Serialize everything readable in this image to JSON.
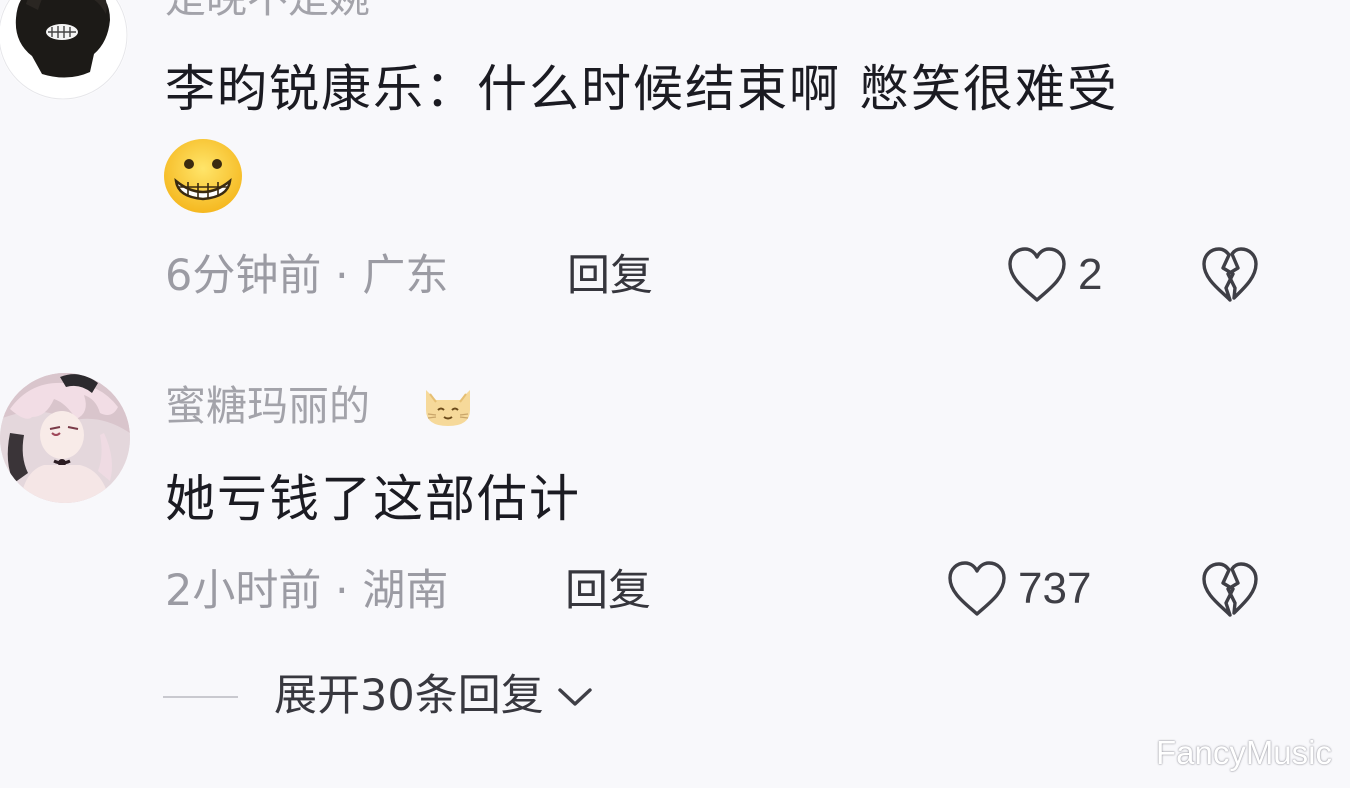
{
  "comments": [
    {
      "username": "是晚不是婉",
      "text": "李昀锐康乐：什么时候结束啊 憋笑很难受",
      "time_location": "6分钟前 · 广东",
      "reply_label": "回复",
      "like_count": "2",
      "emoji": "grinning-face"
    },
    {
      "username": "蜜糖玛丽的",
      "username_emoji": "cat-face",
      "text": "她亏钱了这部估计",
      "time_location": "2小时前 · 湖南",
      "reply_label": "回复",
      "like_count": "737"
    }
  ],
  "expand_replies_label": "展开30条回复",
  "watermark": "FancyMusic",
  "colors": {
    "background": "#f8f8fb",
    "username": "#a3a3aa",
    "body_text": "#1b1b22",
    "meta_text": "#9b9ba3"
  }
}
